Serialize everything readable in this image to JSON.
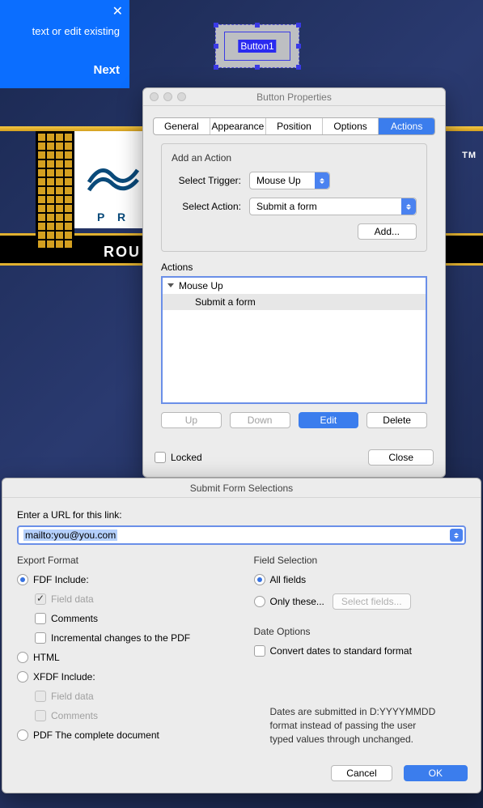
{
  "tooltip": {
    "message": "text or edit existing",
    "next": "Next"
  },
  "canvas": {
    "button_label": "Button1",
    "tm": "TM",
    "bg_title": "ROU",
    "bg_logo": "P   R"
  },
  "bp": {
    "title": "Button Properties",
    "tabs": [
      "General",
      "Appearance",
      "Position",
      "Options",
      "Actions"
    ],
    "active_tab": 4,
    "add_action_title": "Add an Action",
    "trigger_label": "Select Trigger:",
    "trigger_value": "Mouse Up",
    "action_label": "Select Action:",
    "action_value": "Submit a form",
    "add_btn": "Add...",
    "actions_title": "Actions",
    "action_tree": {
      "trigger": "Mouse Up",
      "action": "Submit a form"
    },
    "btns": {
      "up": "Up",
      "down": "Down",
      "edit": "Edit",
      "delete": "Delete"
    },
    "locked": "Locked",
    "close": "Close"
  },
  "sfs": {
    "title": "Submit Form Selections",
    "url_label": "Enter a URL for this link:",
    "url_value": "mailto:you@you.com",
    "export": {
      "title": "Export Format",
      "fdf": "FDF  Include:",
      "fdf_field": "Field data",
      "fdf_comments": "Comments",
      "fdf_incremental": "Incremental changes to the PDF",
      "html": "HTML",
      "xfdf": "XFDF  Include:",
      "xfdf_field": "Field data",
      "xfdf_comments": "Comments",
      "pdf": "PDF  The complete document"
    },
    "fields": {
      "title": "Field Selection",
      "all": "All fields",
      "only": "Only these...",
      "select_btn": "Select fields..."
    },
    "dates": {
      "title": "Date Options",
      "convert": "Convert dates to standard format",
      "note": "Dates are submitted in D:YYYYMMDD format instead of passing the user typed values through unchanged."
    },
    "cancel": "Cancel",
    "ok": "OK"
  }
}
